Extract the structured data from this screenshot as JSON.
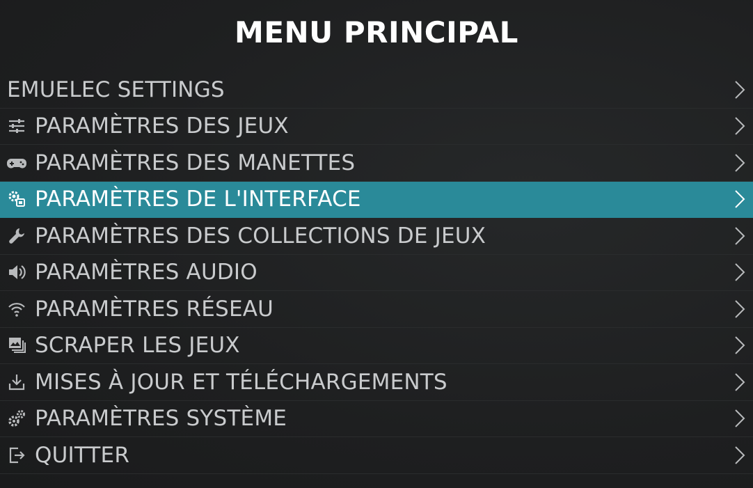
{
  "title": "MENU PRINCIPAL",
  "colors": {
    "background": "#1d1e1f",
    "selected": "#2a8a99",
    "text": "#c9cbcd",
    "title": "#ffffff"
  },
  "items": [
    {
      "label": "EMUELEC SETTINGS",
      "icon": "none",
      "selected": false
    },
    {
      "label": "PARAMÈTRES DES JEUX",
      "icon": "sliders-icon",
      "selected": false
    },
    {
      "label": "PARAMÈTRES DES MANETTES",
      "icon": "gamepad-icon",
      "selected": false
    },
    {
      "label": "PARAMÈTRES DE L'INTERFACE",
      "icon": "ui-settings-icon",
      "selected": true
    },
    {
      "label": "PARAMÈTRES DES COLLECTIONS DE JEUX",
      "icon": "wrench-icon",
      "selected": false
    },
    {
      "label": "PARAMÈTRES AUDIO",
      "icon": "speaker-icon",
      "selected": false
    },
    {
      "label": "PARAMÈTRES RÉSEAU",
      "icon": "wifi-icon",
      "selected": false
    },
    {
      "label": "SCRAPER LES JEUX",
      "icon": "images-icon",
      "selected": false
    },
    {
      "label": "MISES À JOUR ET TÉLÉCHARGEMENTS",
      "icon": "download-icon",
      "selected": false
    },
    {
      "label": "PARAMÈTRES SYSTÈME",
      "icon": "gears-icon",
      "selected": false
    },
    {
      "label": "QUITTER",
      "icon": "exit-icon",
      "selected": false
    }
  ]
}
